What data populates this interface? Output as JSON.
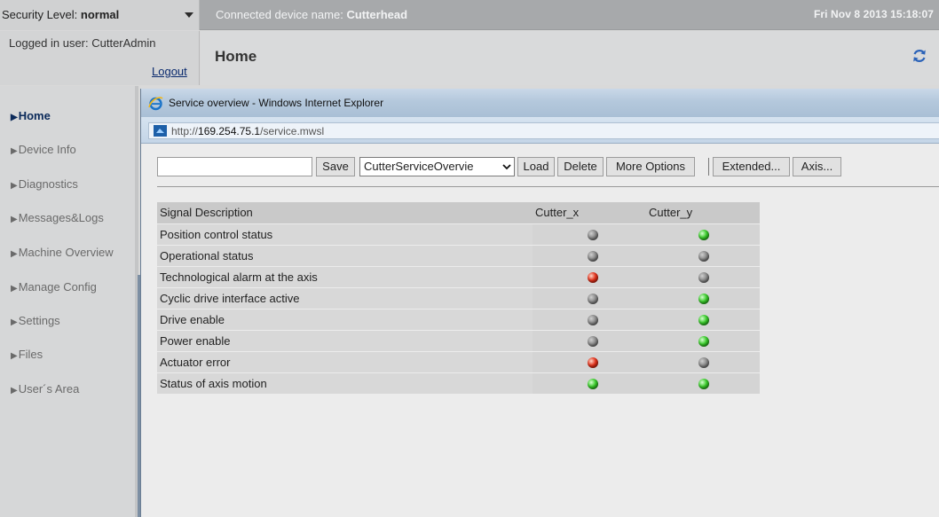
{
  "topbar": {
    "security_label": "Security Level:",
    "security_value": "normal",
    "device_label": "Connected device name:",
    "device_value": "Cutterhead",
    "datetime": "Fri Nov 8 2013  15:18:07"
  },
  "header": {
    "logged_user": "Logged in user: CutterAdmin",
    "logout": "Logout",
    "page_title": "Home"
  },
  "sidebar": {
    "items": [
      {
        "label": "Home",
        "active": true
      },
      {
        "label": "Device Info"
      },
      {
        "label": "Diagnostics"
      },
      {
        "label": "Messages&Logs"
      },
      {
        "label": "Machine Overview"
      },
      {
        "label": "Manage Config"
      },
      {
        "label": "Settings"
      },
      {
        "label": "Files"
      },
      {
        "label": "User´s Area"
      }
    ]
  },
  "ie": {
    "title": "Service overview - Windows Internet Explorer",
    "address_prefix": "http://",
    "address_host": "169.254.75.1",
    "address_path": "/service.mwsl"
  },
  "toolbar": {
    "name_input_value": "",
    "save": "Save",
    "config_select": "CutterServiceOvervie",
    "load": "Load",
    "delete": "Delete",
    "more_options": "More Options",
    "extended": "Extended...",
    "axis": "Axis..."
  },
  "table": {
    "headers": [
      "Signal Description",
      "Cutter_x",
      "Cutter_y"
    ],
    "rows": [
      {
        "desc": "Position control status",
        "cutter_x": "gray",
        "cutter_y": "green"
      },
      {
        "desc": "Operational status",
        "cutter_x": "gray",
        "cutter_y": "gray"
      },
      {
        "desc": "Technological alarm at the axis",
        "cutter_x": "red",
        "cutter_y": "gray"
      },
      {
        "desc": "Cyclic drive interface active",
        "cutter_x": "gray",
        "cutter_y": "green"
      },
      {
        "desc": "Drive enable",
        "cutter_x": "gray",
        "cutter_y": "green"
      },
      {
        "desc": "Power enable",
        "cutter_x": "gray",
        "cutter_y": "green"
      },
      {
        "desc": "Actuator error",
        "cutter_x": "red",
        "cutter_y": "gray"
      },
      {
        "desc": "Status of axis motion",
        "cutter_x": "green",
        "cutter_y": "green"
      }
    ]
  },
  "colors": {
    "led_gray": "#8a8a8a",
    "led_green": "#39c92a",
    "led_red": "#e0321c",
    "topbar_bg": "#a7a9ab",
    "ie_titlebar": "#b4c8dc"
  },
  "icons": {
    "refresh": "refresh-icon",
    "ie_logo": "ie-logo-icon",
    "address_page": "page-icon",
    "select_chevron": "chevron-down-icon",
    "security_dropdown": "triangle-down-icon",
    "sidebar_bullet": "triangle-right-icon"
  }
}
